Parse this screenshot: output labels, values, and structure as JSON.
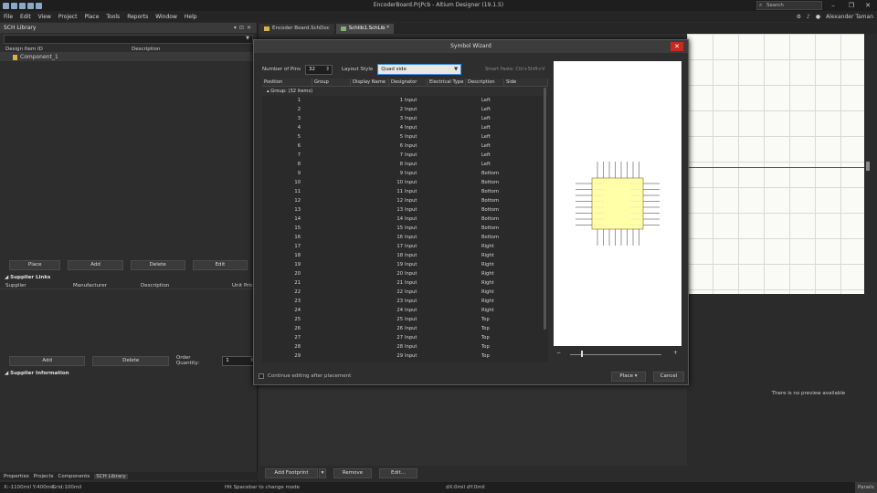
{
  "window": {
    "title": "EncoderBoard.PrjPcb - Altium Designer (19.1.5)",
    "search_label": "Search",
    "user": "Alexander Taman"
  },
  "menu": [
    "File",
    "Edit",
    "View",
    "Project",
    "Place",
    "Tools",
    "Reports",
    "Window",
    "Help"
  ],
  "left_panel": {
    "title": "SCH Library",
    "columns": [
      "Design Item ID",
      "Description"
    ],
    "items": [
      "Component_1"
    ],
    "buttons": [
      "Place",
      "Add",
      "Delete",
      "Edit"
    ],
    "supplier_links_title": "Supplier Links",
    "supplier_columns": [
      "Supplier",
      "Manufacturer",
      "Description",
      "Unit Pric"
    ],
    "supplier_buttons": [
      "Add",
      "Delete"
    ],
    "order_quantity_label": "Order Quantity:",
    "order_quantity_value": "1",
    "supplier_info_title": "Supplier Information",
    "bottom_tabs": [
      "Properties",
      "Projects",
      "Components",
      "SCH Library"
    ]
  },
  "doc_tabs": [
    "Encoder Board.SchDoc",
    "Schlib1.SchLib *"
  ],
  "dialog": {
    "title": "Symbol Wizard",
    "number_of_pins_label": "Number of Pins",
    "number_of_pins": "32",
    "layout_style_label": "Layout Style",
    "layout_style": "Quad side",
    "smart_paste": "Smart Paste: Ctrl+Shift+V",
    "columns": [
      "Position",
      "Group",
      "Display Name",
      "Designator",
      "Electrical Type",
      "Description",
      "Side"
    ],
    "group_row": "Group:   (32 items)",
    "rows": [
      {
        "pos": "1",
        "des": "1",
        "type": "Input",
        "side": "Left"
      },
      {
        "pos": "2",
        "des": "2",
        "type": "Input",
        "side": "Left"
      },
      {
        "pos": "3",
        "des": "3",
        "type": "Input",
        "side": "Left"
      },
      {
        "pos": "4",
        "des": "4",
        "type": "Input",
        "side": "Left"
      },
      {
        "pos": "5",
        "des": "5",
        "type": "Input",
        "side": "Left"
      },
      {
        "pos": "6",
        "des": "6",
        "type": "Input",
        "side": "Left"
      },
      {
        "pos": "7",
        "des": "7",
        "type": "Input",
        "side": "Left"
      },
      {
        "pos": "8",
        "des": "8",
        "type": "Input",
        "side": "Left"
      },
      {
        "pos": "9",
        "des": "9",
        "type": "Input",
        "side": "Bottom"
      },
      {
        "pos": "10",
        "des": "10",
        "type": "Input",
        "side": "Bottom"
      },
      {
        "pos": "11",
        "des": "11",
        "type": "Input",
        "side": "Bottom"
      },
      {
        "pos": "12",
        "des": "12",
        "type": "Input",
        "side": "Bottom"
      },
      {
        "pos": "13",
        "des": "13",
        "type": "Input",
        "side": "Bottom"
      },
      {
        "pos": "14",
        "des": "14",
        "type": "Input",
        "side": "Bottom"
      },
      {
        "pos": "15",
        "des": "15",
        "type": "Input",
        "side": "Bottom"
      },
      {
        "pos": "16",
        "des": "16",
        "type": "Input",
        "side": "Bottom"
      },
      {
        "pos": "17",
        "des": "17",
        "type": "Input",
        "side": "Right"
      },
      {
        "pos": "18",
        "des": "18",
        "type": "Input",
        "side": "Right"
      },
      {
        "pos": "19",
        "des": "19",
        "type": "Input",
        "side": "Right"
      },
      {
        "pos": "20",
        "des": "20",
        "type": "Input",
        "side": "Right"
      },
      {
        "pos": "21",
        "des": "21",
        "type": "Input",
        "side": "Right"
      },
      {
        "pos": "22",
        "des": "22",
        "type": "Input",
        "side": "Right"
      },
      {
        "pos": "23",
        "des": "23",
        "type": "Input",
        "side": "Right"
      },
      {
        "pos": "24",
        "des": "24",
        "type": "Input",
        "side": "Right"
      },
      {
        "pos": "25",
        "des": "25",
        "type": "Input",
        "side": "Top"
      },
      {
        "pos": "26",
        "des": "26",
        "type": "Input",
        "side": "Top"
      },
      {
        "pos": "27",
        "des": "27",
        "type": "Input",
        "side": "Top"
      },
      {
        "pos": "28",
        "des": "28",
        "type": "Input",
        "side": "Top"
      },
      {
        "pos": "29",
        "des": "29",
        "type": "Input",
        "side": "Top"
      }
    ],
    "continue_editing": "Continue editing after placement",
    "place_label": "Place",
    "cancel_label": "Cancel"
  },
  "right_panel": {
    "no_preview": "There is no preview available"
  },
  "lower_bar": {
    "add_footprint": "Add Footprint",
    "remove": "Remove",
    "edit": "Edit..."
  },
  "status": {
    "coords": "X:-1100mil Y:400mil",
    "grid": "Grid:100mil",
    "hint": "Hit Spacebar to change mode",
    "delta": "dX:0mil dY:0mil",
    "panels": "Panels"
  },
  "colors": {
    "accent": "#3a8ee6",
    "close": "#c42b1c",
    "symbol_body": "#ffffa8"
  }
}
